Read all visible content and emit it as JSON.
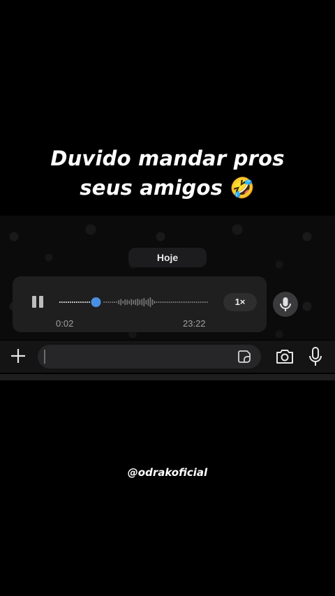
{
  "caption": {
    "line1": "Duvido mandar pros",
    "line2": "seus amigos",
    "emoji": "🤣"
  },
  "chat": {
    "date_label": "Hoje",
    "voice_message": {
      "state": "playing",
      "control_icon": "pause-icon",
      "elapsed": "0:02",
      "duration": "23:22",
      "playback_speed": "1×",
      "progress_fraction": 0.25,
      "accent_color": "#4a90e2"
    },
    "side_button_icon": "microphone-icon"
  },
  "input_bar": {
    "attach_icon": "plus-icon",
    "placeholder": "",
    "sticker_icon": "sticker-icon",
    "camera_icon": "camera-icon",
    "voice_icon": "microphone-icon"
  },
  "watermark": "@odrakoficial"
}
